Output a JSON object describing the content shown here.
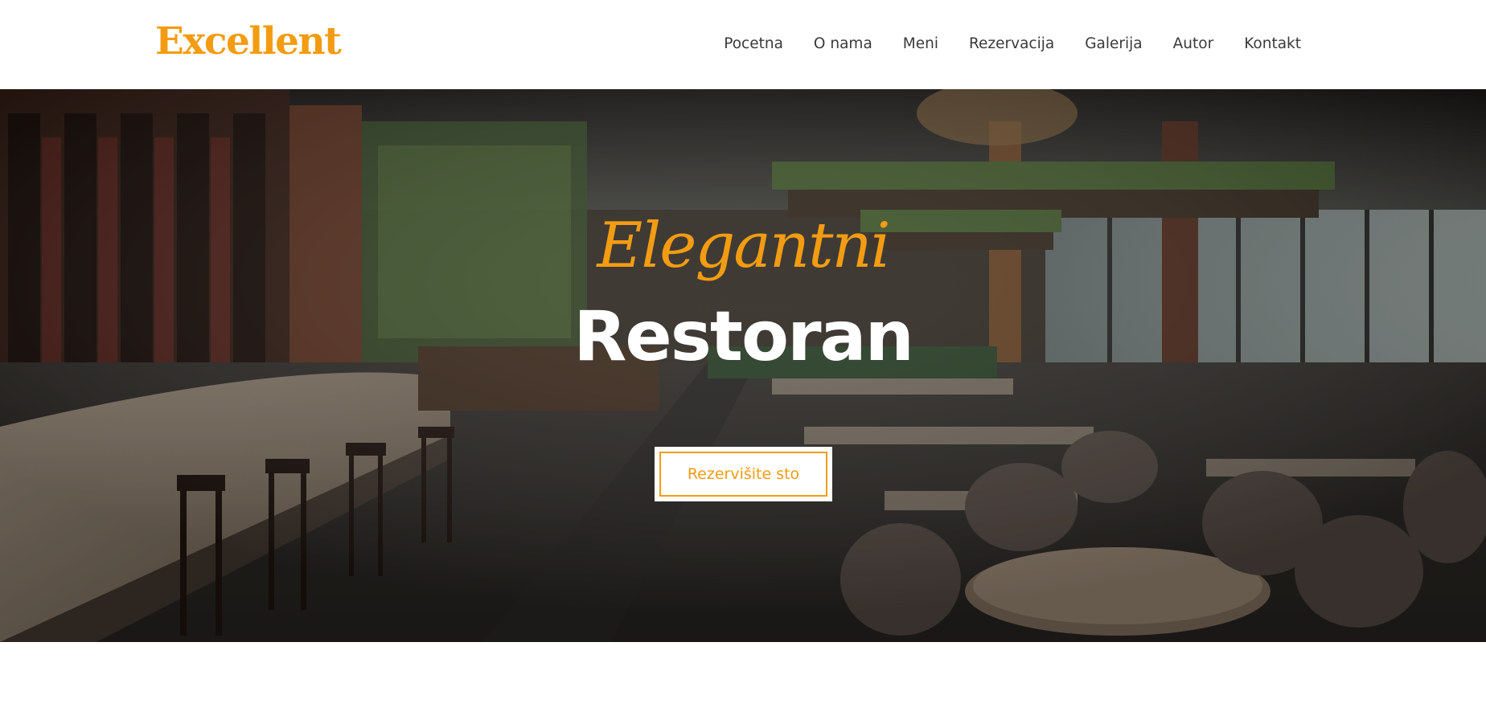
{
  "brand": {
    "logo_text": "Excellent",
    "accent_color": "#f39c12"
  },
  "nav": {
    "items": [
      {
        "label": "Pocetna"
      },
      {
        "label": "O nama"
      },
      {
        "label": "Meni"
      },
      {
        "label": "Rezervacija"
      },
      {
        "label": "Galerija"
      },
      {
        "label": "Autor"
      },
      {
        "label": "Kontakt"
      }
    ]
  },
  "hero": {
    "script_title": "Elegantni",
    "main_title": "Restoran",
    "cta_label": "Rezervišite sto",
    "background_image": "restaurant-interior-photo"
  }
}
